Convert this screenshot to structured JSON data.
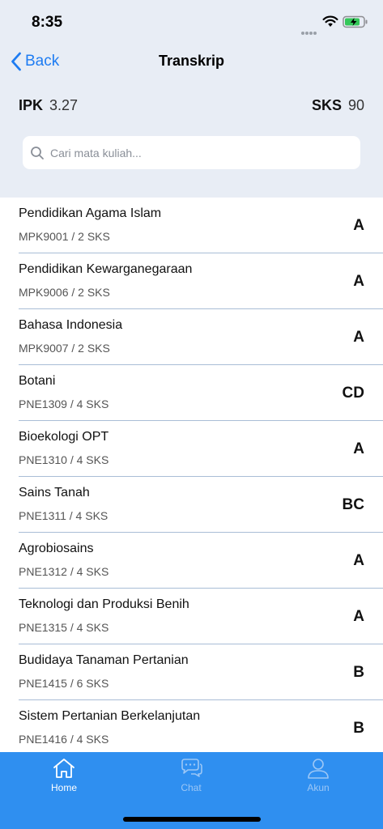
{
  "status_bar": {
    "time": "8:35"
  },
  "nav": {
    "back_label": "Back",
    "title": "Transkrip"
  },
  "summary": {
    "ipk_label": "IPK",
    "ipk_value": "3.27",
    "sks_label": "SKS",
    "sks_value": "90"
  },
  "search": {
    "placeholder": "Cari mata kuliah..."
  },
  "courses": [
    {
      "name": "Pendidikan Agama Islam",
      "meta": "MPK9001 / 2 SKS",
      "grade": "A"
    },
    {
      "name": "Pendidikan Kewarganegaraan",
      "meta": "MPK9006 / 2 SKS",
      "grade": "A"
    },
    {
      "name": "Bahasa Indonesia",
      "meta": "MPK9007 / 2 SKS",
      "grade": "A"
    },
    {
      "name": "Botani",
      "meta": "PNE1309 / 4 SKS",
      "grade": "CD"
    },
    {
      "name": "Bioekologi OPT",
      "meta": "PNE1310 / 4 SKS",
      "grade": "A"
    },
    {
      "name": "Sains Tanah",
      "meta": "PNE1311 / 4 SKS",
      "grade": "BC"
    },
    {
      "name": "Agrobiosains",
      "meta": "PNE1312 / 4 SKS",
      "grade": "A"
    },
    {
      "name": "Teknologi dan Produksi Benih",
      "meta": "PNE1315 / 4 SKS",
      "grade": "A"
    },
    {
      "name": "Budidaya Tanaman Pertanian",
      "meta": "PNE1415 / 6 SKS",
      "grade": "B"
    },
    {
      "name": "Sistem Pertanian Berkelanjutan",
      "meta": "PNE1416 / 4 SKS",
      "grade": "B"
    }
  ],
  "tabs": [
    {
      "label": "Home",
      "icon": "home-icon",
      "active": true
    },
    {
      "label": "Chat",
      "icon": "chat-icon",
      "active": false
    },
    {
      "label": "Akun",
      "icon": "user-icon",
      "active": false
    }
  ],
  "colors": {
    "accent": "#1e7cf2",
    "tabbar": "#2f8ff0",
    "header_bg": "#e8edf5",
    "divider": "#a9bdd6"
  }
}
